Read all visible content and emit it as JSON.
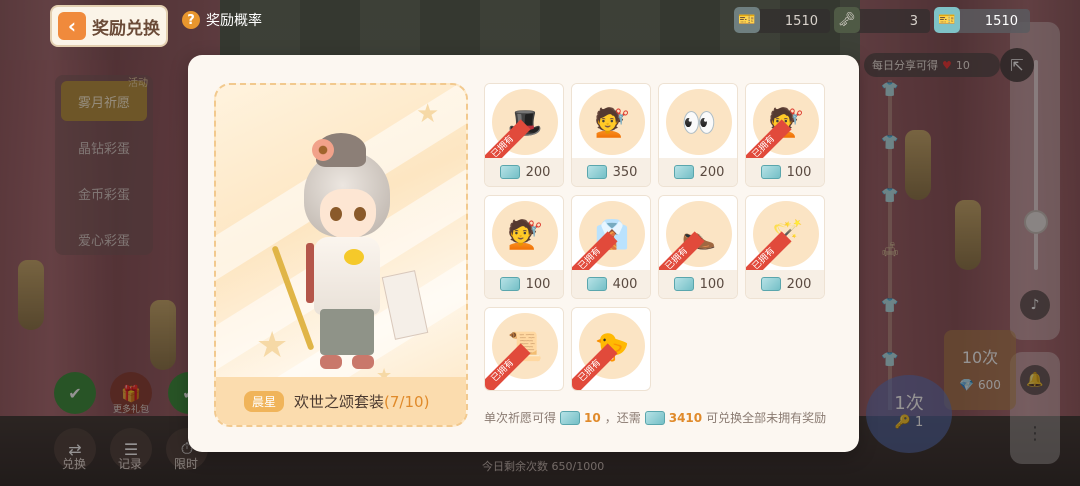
{
  "top": {
    "back_label": "奖励兑换",
    "prob_label": "奖励概率",
    "res1": "1510",
    "res2": "3",
    "res3": "1510"
  },
  "side": {
    "tag": "活动",
    "items": [
      "雾月祈愿",
      "晶钻彩蛋",
      "金币彩蛋",
      "爱心彩蛋"
    ]
  },
  "bottom_left": {
    "labels": [
      "兑换",
      "记录",
      "限时"
    ],
    "more_gift": "更多礼包"
  },
  "right": {
    "share_text": "每日分享可得",
    "share_count": "10",
    "draw10_label": "10次",
    "draw10_cost": "600",
    "draw1_label": "1次",
    "draw1_cost": "1",
    "today_text": "今日剩余次数 650/1000"
  },
  "modal": {
    "suit_tag": "晨星",
    "suit_name": "欢世之颂套装",
    "suit_progress": "(7/10)",
    "owned_label": "已拥有",
    "items": [
      {
        "icon": "hat-icon",
        "price": "200",
        "owned": true
      },
      {
        "icon": "hair-icon",
        "price": "350",
        "owned": false
      },
      {
        "icon": "eyes-icon",
        "price": "200",
        "owned": false
      },
      {
        "icon": "hair-icon",
        "price": "100",
        "owned": true
      },
      {
        "icon": "hair-icon",
        "price": "100",
        "owned": false
      },
      {
        "icon": "outfit-icon",
        "price": "400",
        "owned": true
      },
      {
        "icon": "shoes-icon",
        "price": "100",
        "owned": true
      },
      {
        "icon": "staff-icon",
        "price": "200",
        "owned": true
      },
      {
        "icon": "scroll-icon",
        "price": "",
        "owned": true
      },
      {
        "icon": "bird-icon",
        "price": "",
        "owned": true
      }
    ],
    "summary": {
      "prefix": "单次祈愿可得",
      "count": "10",
      "mid": "，还需",
      "need": "3410",
      "suffix": "可兑换全部未拥有奖励"
    }
  },
  "colors": {
    "accent": "#e08a2a",
    "owned_badge": "#e14a3b",
    "modal_bg": "#fcf7f1"
  }
}
